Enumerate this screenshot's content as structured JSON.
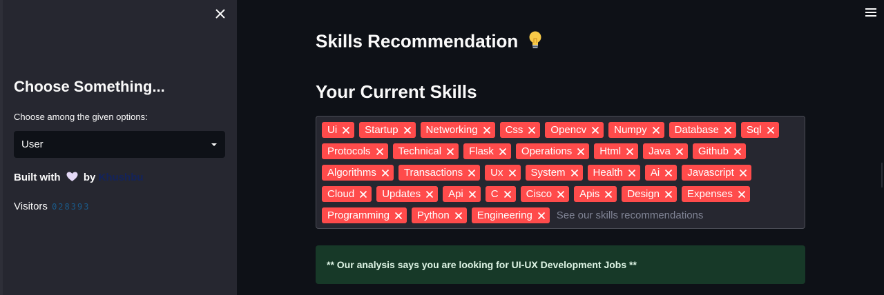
{
  "sidebar": {
    "title": "Choose Something...",
    "select_label": "Choose among the given options:",
    "select_value": "User",
    "built_prefix": "Built with",
    "built_by": "by",
    "author": "Khushbu",
    "visitors_label": "Visitors",
    "visitors_count": "028393"
  },
  "main": {
    "title": "Skills Recommendation",
    "subtitle": "Your Current Skills",
    "skills": [
      "Ui",
      "Startup",
      "Networking",
      "Css",
      "Opencv",
      "Numpy",
      "Database",
      "Sql",
      "Protocols",
      "Technical",
      "Flask",
      "Operations",
      "Html",
      "Java",
      "Github",
      "Algorithms",
      "Transactions",
      "Ux",
      "System",
      "Health",
      "Ai",
      "Javascript",
      "Cloud",
      "Updates",
      "Api",
      "C",
      "Cisco",
      "Apis",
      "Design",
      "Expenses",
      "Programming",
      "Python",
      "Engineering"
    ],
    "input_placeholder": "See our skills recommendations",
    "alert": "** Our analysis says you are looking for UI-UX Development Jobs **"
  },
  "colors": {
    "background": "#0e1117",
    "sidebar": "#262730",
    "tag": "#ff4b4b",
    "alert_bg": "#173928"
  },
  "icons": {
    "close": "close-icon",
    "menu": "hamburger-menu-icon",
    "caret": "chevron-down-icon",
    "heart": "heart-icon",
    "bulb": "light-bulb-icon"
  }
}
